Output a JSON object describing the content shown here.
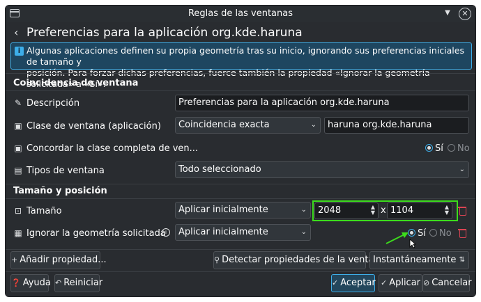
{
  "window": {
    "title": "Reglas de las ventanas"
  },
  "header": {
    "title": "Preferencias para la aplicación org.kde.haruna"
  },
  "info": {
    "line1": "Algunas aplicaciones definen su propia geometría tras su inicio, ignorando sus preferencias iniciales de tamaño y",
    "line2": "posición. Para forzar dichas preferencias, fuerce también la propiedad «Ignorar la geometría solicitada» a «Sí»."
  },
  "section_match": {
    "title": "Coincidencia de ventana"
  },
  "description": {
    "label": "Descripción",
    "value": "Preferencias para la aplicación org.kde.haruna"
  },
  "window_class": {
    "label": "Clase de ventana (aplicación)",
    "match": "Coincidencia exacta",
    "value": "haruna org.kde.haruna"
  },
  "full_class": {
    "label": "Concordar la clase completa de ven...",
    "yes": "Sí",
    "no": "No",
    "selected": "Sí"
  },
  "window_types": {
    "label": "Tipos de ventana",
    "value": "Todo seleccionado"
  },
  "section_size": {
    "title": "Tamaño y posición"
  },
  "size": {
    "label": "Tamaño",
    "policy": "Aplicar inicialmente",
    "width": "2048",
    "x": "x",
    "height": "1104"
  },
  "ignore_geometry": {
    "label": "Ignorar la geometría solicitada",
    "policy": "Aplicar inicialmente",
    "yes": "Sí",
    "no": "No",
    "selected": "Sí"
  },
  "bottom": {
    "add_property": "Añadir propiedad...",
    "detect": "Detectar propiedades de la ventana",
    "detect_mode": "Instantáneamente"
  },
  "footer": {
    "help": "Ayuda",
    "reset": "Reiniciar",
    "accept": "Aceptar",
    "apply": "Aplicar",
    "cancel": "Cancelar"
  },
  "colors": {
    "accent": "#3daee9",
    "highlight_box": "#3cdc1c",
    "danger": "#da4453",
    "background": "#292c30"
  }
}
